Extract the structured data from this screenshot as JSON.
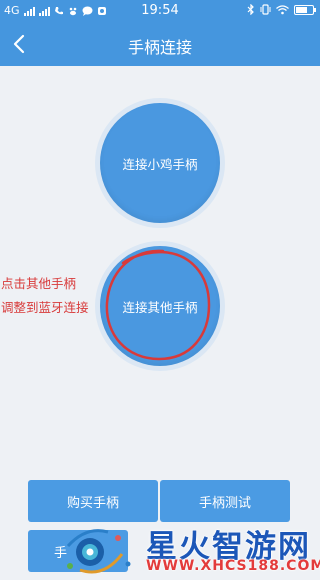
{
  "status_bar": {
    "network": "4G",
    "time": "19:54"
  },
  "header": {
    "title": "手柄连接"
  },
  "main": {
    "connect_xiaoji_label": "连接小鸡手柄",
    "connect_other_label": "连接其他手柄"
  },
  "annotation": {
    "line1": "点击其他手柄",
    "line2": "调整到蓝牙连接",
    "color": "#d83a3a"
  },
  "bottom": {
    "buy_label": "购买手柄",
    "test_label": "手柄测试",
    "third_label": "手"
  },
  "watermark": {
    "name": "星火智游网",
    "url": "WWW.XHCS188.COM"
  },
  "colors": {
    "accent": "#4596de",
    "circle": "#4a98e0",
    "background": "#eef1f5"
  }
}
